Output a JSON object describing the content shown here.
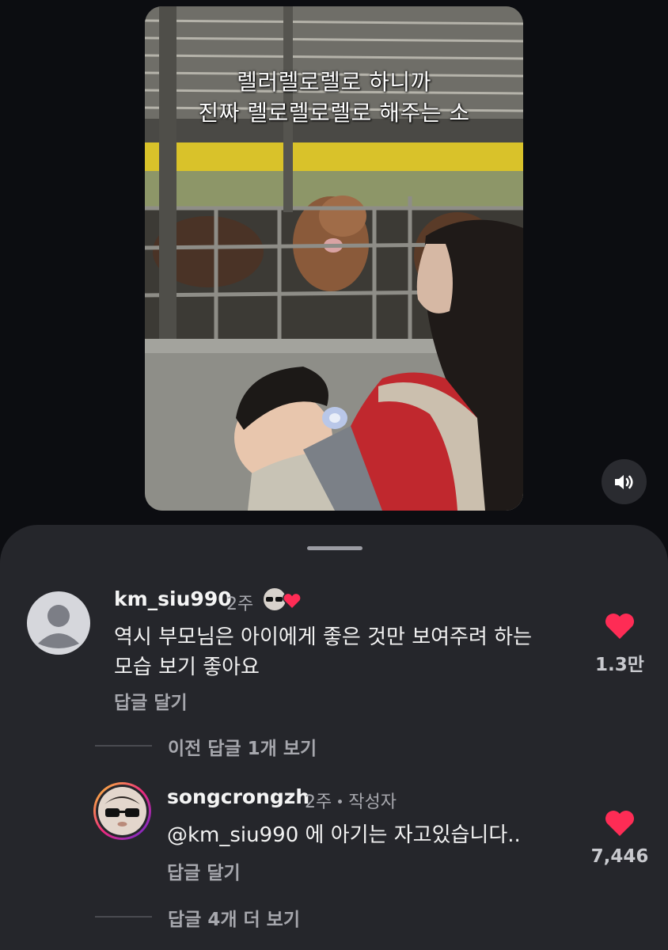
{
  "video": {
    "caption_line1": "렐러렐로렐로 하니까",
    "caption_line2": "진짜 렐로렐로렐로 해주는 소",
    "mute_icon": "speaker-volume-icon"
  },
  "comments": [
    {
      "username": "km_siu990",
      "time": "2주",
      "badge": "creator-liked-avatar-heart",
      "text_line1": "역시 부모님은 아이에게 좋은 것만 보여주려 하는",
      "text_line2": "모습 보기 좋아요",
      "reply_label": "답글 달기",
      "likes": "1.3만",
      "liked": true
    }
  ],
  "thread": {
    "prev_replies_label": "이전 답글 1개 보기",
    "reply": {
      "username": "songcrongzh",
      "time": "2주",
      "author_tag": "작성자",
      "mention": "@km_siu990",
      "text": " 에 아기는 자고있습니다..",
      "reply_label": "답글 달기",
      "likes": "7,446",
      "liked": true
    },
    "more_replies_label": "답글 4개 더 보기"
  },
  "colors": {
    "background": "#0c0d11",
    "sheet": "#25262b",
    "heart": "#fe2c55",
    "muted_text": "#a6a7ad"
  }
}
